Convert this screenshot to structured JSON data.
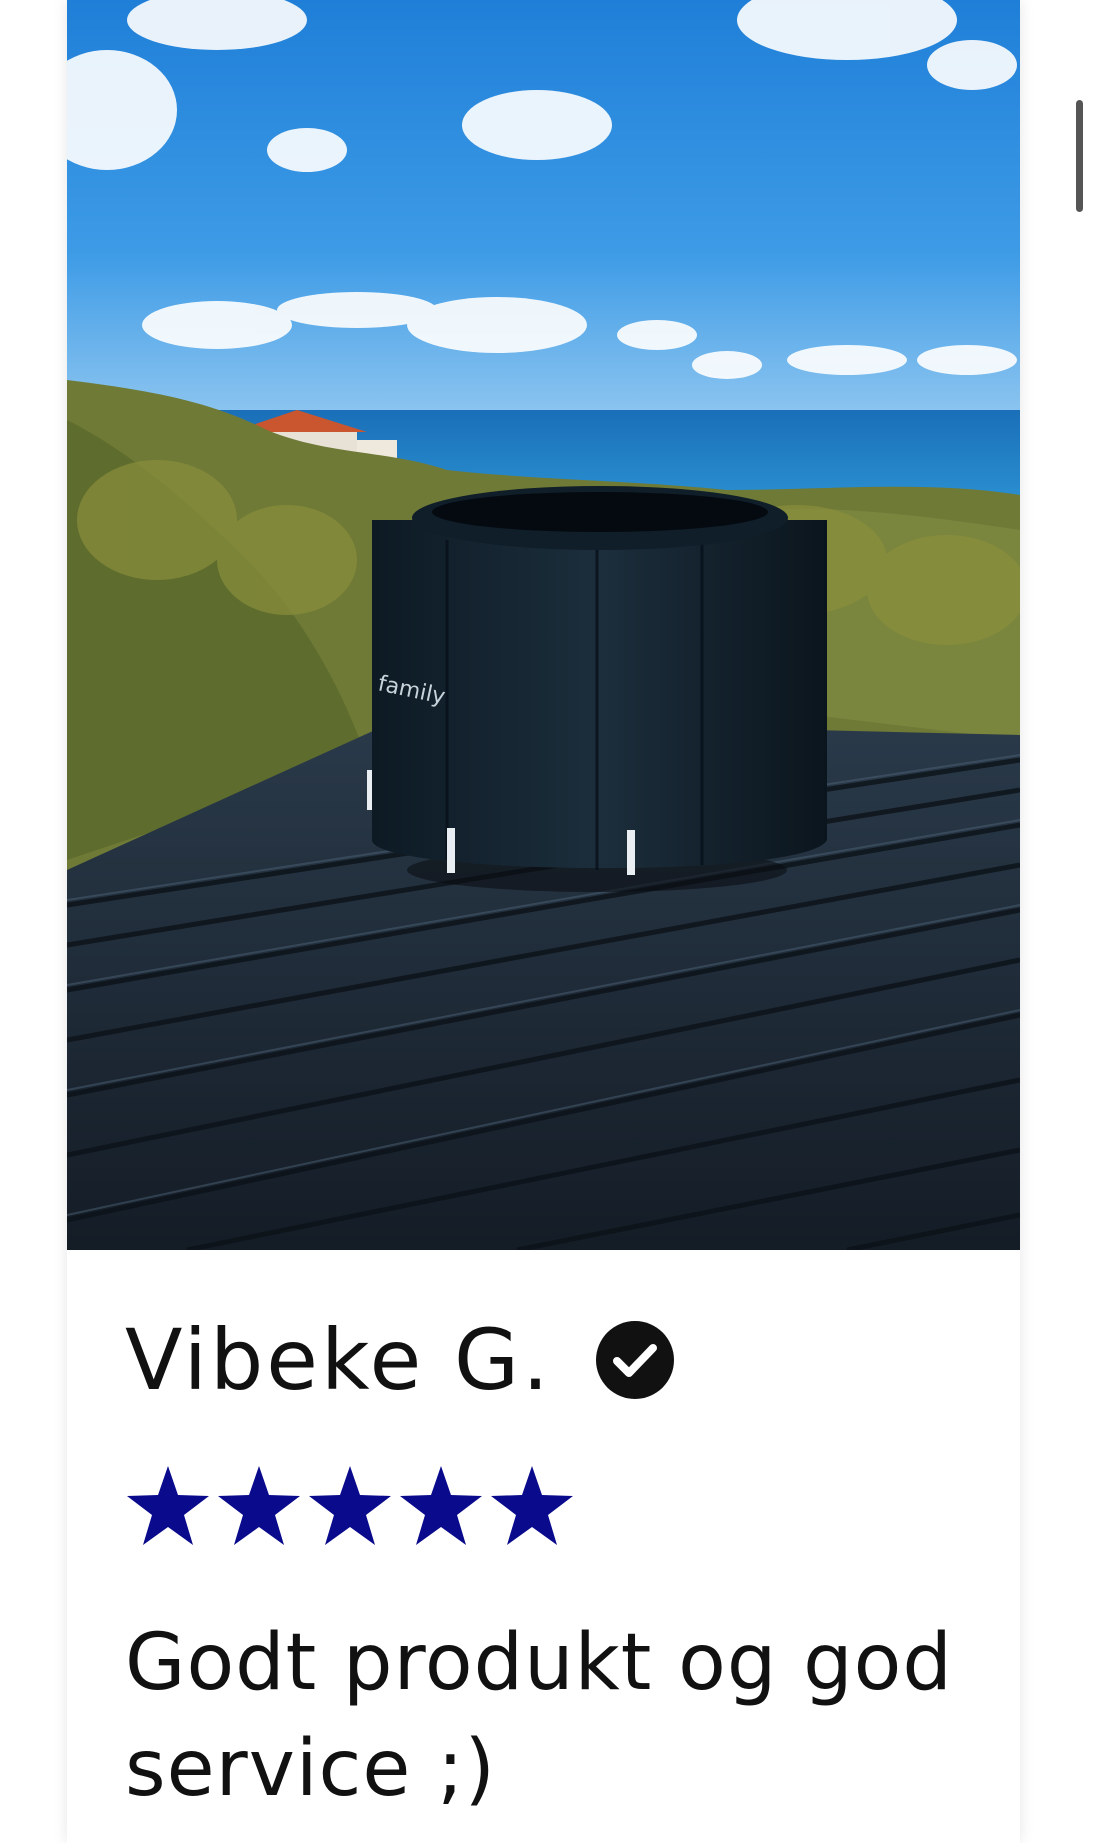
{
  "review": {
    "reviewer_name": "Vibeke G.",
    "verified_icon": "check-circle-icon",
    "rating": 5,
    "rating_max": 5,
    "text": "Godt produkt og god service ;)",
    "star_color": "#0a0a8c"
  },
  "photo": {
    "product_logo_text": "family"
  },
  "colors": {
    "text": "#111111",
    "card_background": "#ffffff",
    "star": "#0a0a8c",
    "scrollbar": "#555555"
  }
}
